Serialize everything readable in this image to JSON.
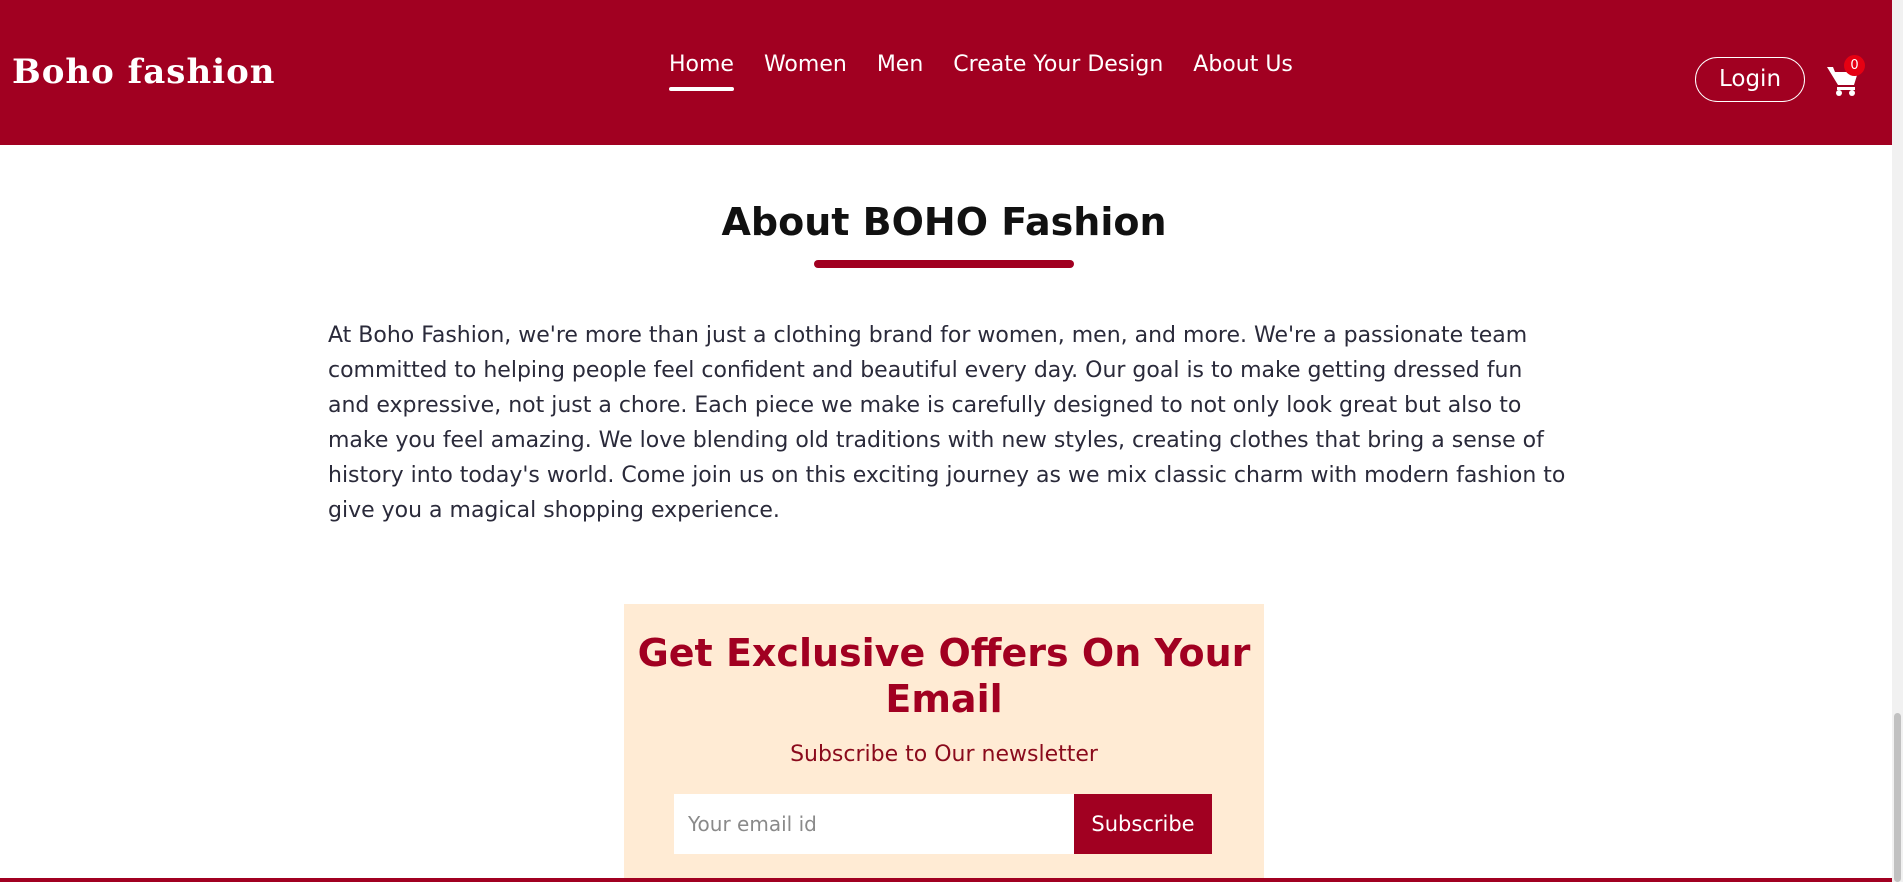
{
  "header": {
    "brand": "Boho fashion",
    "nav": [
      {
        "label": "Home",
        "active": true
      },
      {
        "label": "Women",
        "active": false
      },
      {
        "label": "Men",
        "active": false
      },
      {
        "label": "Create Your Design",
        "active": false
      },
      {
        "label": "About Us",
        "active": false
      }
    ],
    "login_label": "Login",
    "cart_icon": "cart-icon",
    "cart_count": "0"
  },
  "about": {
    "title": "About BOHO Fashion",
    "body": "At Boho Fashion, we're more than just a clothing brand for women, men, and more. We're a passionate team committed to helping people feel confident and beautiful every day. Our goal is to make getting dressed fun and expressive, not just a chore. Each piece we make is carefully designed to not only look great but also to make you feel amazing. We love blending old traditions with new styles, creating clothes that bring a sense of history into today's world. Come join us on this exciting journey as we mix classic charm with modern fashion to give you a magical shopping experience."
  },
  "newsletter": {
    "title": "Get Exclusive Offers On Your Email",
    "subtitle": "Subscribe to Our newsletter",
    "email_placeholder": "Your email id",
    "email_value": "",
    "subscribe_label": "Subscribe"
  },
  "colors": {
    "brand": "#a10021",
    "newsletter_bg": "#ffebd4",
    "badge": "#e60012"
  }
}
